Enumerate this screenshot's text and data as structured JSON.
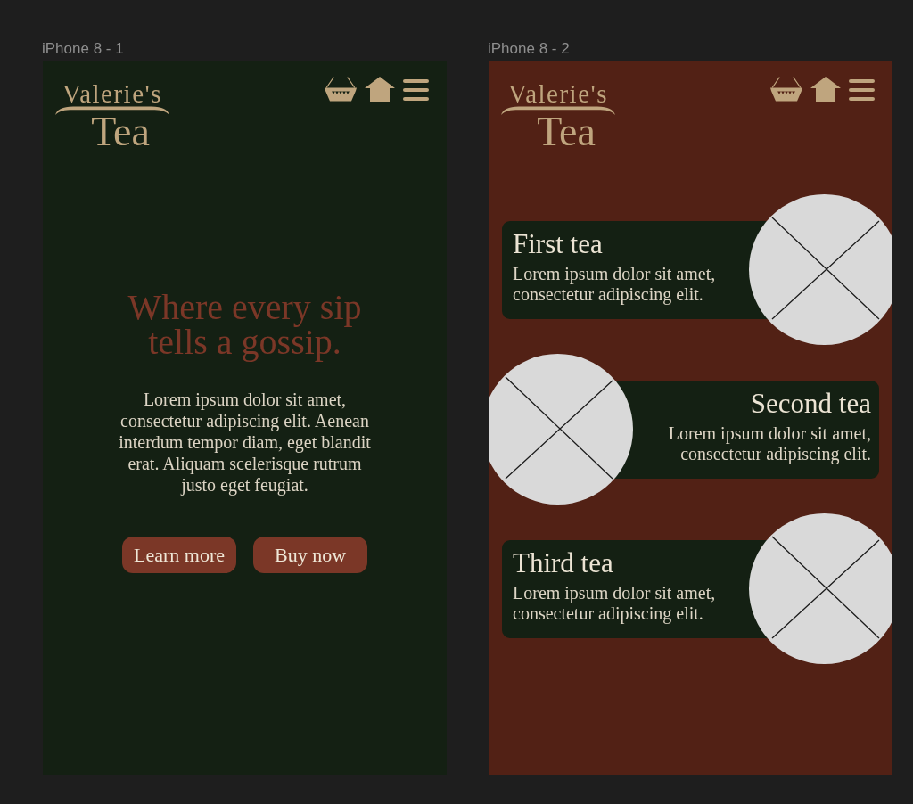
{
  "frames": [
    {
      "kind": "landing",
      "label": "iPhone 8 - 1",
      "logo": {
        "name": "Valerie's",
        "word": "Tea"
      },
      "hero": {
        "headline": "Where every sip tells a gossip.",
        "body": "Lorem ipsum dolor sit amet, consectetur adipiscing elit. Aenean interdum tempor diam, eget blandit erat. Aliquam scelerisque rutrum justo eget feugiat.",
        "buttons": [
          "Learn more",
          "Buy now"
        ]
      }
    },
    {
      "kind": "tea_list",
      "label": "iPhone 8 - 2",
      "logo": {
        "name": "Valerie's",
        "word": "Tea"
      },
      "teas": [
        {
          "kind": "right",
          "name": "First tea",
          "description": "Lorem ipsum dolor sit amet, consectetur adipiscing elit."
        },
        {
          "kind": "left",
          "name": "Second tea",
          "description": "Lorem ipsum dolor sit amet, consectetur adipiscing elit."
        },
        {
          "kind": "right",
          "name": "Third tea",
          "description": "Lorem ipsum dolor sit amet, consectetur adipiscing elit."
        }
      ]
    }
  ]
}
